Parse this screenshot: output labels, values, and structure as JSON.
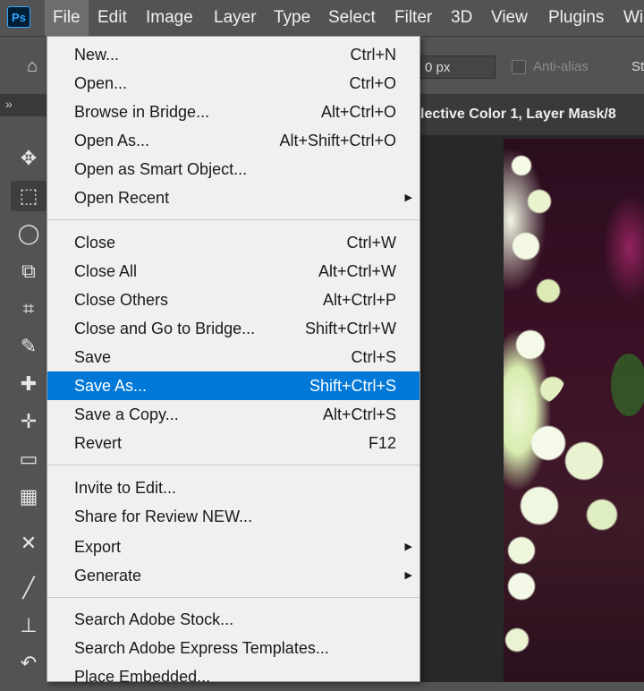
{
  "app": {
    "logo_text": "Ps",
    "menubar": [
      "File",
      "Edit",
      "Image",
      "Layer",
      "Type",
      "Select",
      "Filter",
      "3D",
      "View",
      "Plugins",
      "Wi"
    ]
  },
  "options_bar": {
    "feather_value": "0 px",
    "anti_alias_label": "Anti-alias",
    "style_label": "St"
  },
  "document_tab": {
    "title": "lective Color 1, Layer Mask/8"
  },
  "toolbar": {
    "collapse_glyph": "»"
  },
  "file_menu": {
    "items": [
      {
        "label": "New...",
        "shortcut": "Ctrl+N"
      },
      {
        "label": "Open...",
        "shortcut": "Ctrl+O"
      },
      {
        "label": "Browse in Bridge...",
        "shortcut": "Alt+Ctrl+O"
      },
      {
        "label": "Open As...",
        "shortcut": "Alt+Shift+Ctrl+O"
      },
      {
        "label": "Open as Smart Object...",
        "shortcut": ""
      },
      {
        "label": "Open Recent",
        "shortcut": "",
        "submenu": true
      },
      {
        "label": "Close",
        "shortcut": "Ctrl+W"
      },
      {
        "label": "Close All",
        "shortcut": "Alt+Ctrl+W"
      },
      {
        "label": "Close Others",
        "shortcut": "Alt+Ctrl+P"
      },
      {
        "label": "Close and Go to Bridge...",
        "shortcut": "Shift+Ctrl+W"
      },
      {
        "label": "Save",
        "shortcut": "Ctrl+S"
      },
      {
        "label": "Save As...",
        "shortcut": "Shift+Ctrl+S",
        "highlighted": true
      },
      {
        "label": "Save a Copy...",
        "shortcut": "Alt+Ctrl+S"
      },
      {
        "label": "Revert",
        "shortcut": "F12"
      },
      {
        "label": "Invite to Edit...",
        "shortcut": ""
      },
      {
        "label": "Share for Review NEW...",
        "shortcut": ""
      },
      {
        "label": "Export",
        "shortcut": "",
        "submenu": true
      },
      {
        "label": "Generate",
        "shortcut": "",
        "submenu": true
      },
      {
        "label": "Search Adobe Stock...",
        "shortcut": ""
      },
      {
        "label": "Search Adobe Express Templates...",
        "shortcut": ""
      },
      {
        "label": "Place Embedded...",
        "shortcut": ""
      }
    ]
  },
  "colors": {
    "highlight": "#0078d7",
    "menu_bg": "#f0f0f0",
    "chrome_bg": "#535353"
  }
}
